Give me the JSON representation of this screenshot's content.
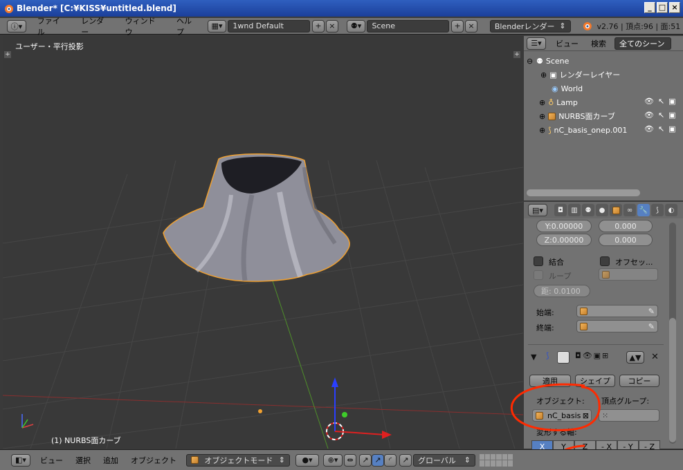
{
  "window": {
    "title": "Blender* [C:¥KISS¥untitled.blend]",
    "buttons": [
      "_",
      "□",
      "×"
    ]
  },
  "header": {
    "menus": [
      "ファイル",
      "レンダー",
      "ウィンドウ",
      "ヘルプ"
    ],
    "screen_layout": "1wnd Default",
    "scene": "Scene",
    "render_engine": "Blenderレンダー",
    "stats": "v2.76 | 頂点:96 | 面:51"
  },
  "viewport": {
    "view_label": "ユーザー・平行投影",
    "selected_object_label": "(1) NURBS面カーブ"
  },
  "outliner": {
    "menus": [
      "ビュー",
      "検索"
    ],
    "filter": "全てのシーン",
    "items": [
      {
        "label": "Scene",
        "icon": "scene-icon"
      },
      {
        "label": "レンダーレイヤー",
        "icon": "render-layer-icon"
      },
      {
        "label": "World",
        "icon": "world-icon"
      },
      {
        "label": "Lamp",
        "icon": "lamp-icon"
      },
      {
        "label": "NURBS面カーブ",
        "icon": "object-icon"
      },
      {
        "label": "nC_basis_onep.001",
        "icon": "curve-icon"
      }
    ]
  },
  "properties": {
    "y_value": "Y:0.00000",
    "z_value": "Z:0.00000",
    "right_value_1": "0.000",
    "right_value_2": "0.000",
    "merge_label": "結合",
    "offset_label": "オフセッ...",
    "loop_label": "ループ",
    "distance_value": "距: 0.0100",
    "start_label": "始端:",
    "end_label": "終端:",
    "apply_button": "適用",
    "shape_button": "シェイプ",
    "copy_button": "コピー",
    "object_label": "オブジェクト:",
    "vertex_group_label": "頂点グループ:",
    "object_value": "nC_basis",
    "deform_axis_label": "変形する軸:",
    "axes": [
      "X",
      "Y",
      "Z",
      "- X",
      "- Y",
      "- Z"
    ],
    "active_axis": "X"
  },
  "footer": {
    "menus": [
      "ビュー",
      "選択",
      "追加",
      "オブジェクト"
    ],
    "mode": "オブジェクトモード",
    "orientation": "グローバル"
  },
  "colors": {
    "accent_blue": "#5680c2",
    "annotation_red": "#ff2a00",
    "selection_orange": "#f0a030"
  }
}
